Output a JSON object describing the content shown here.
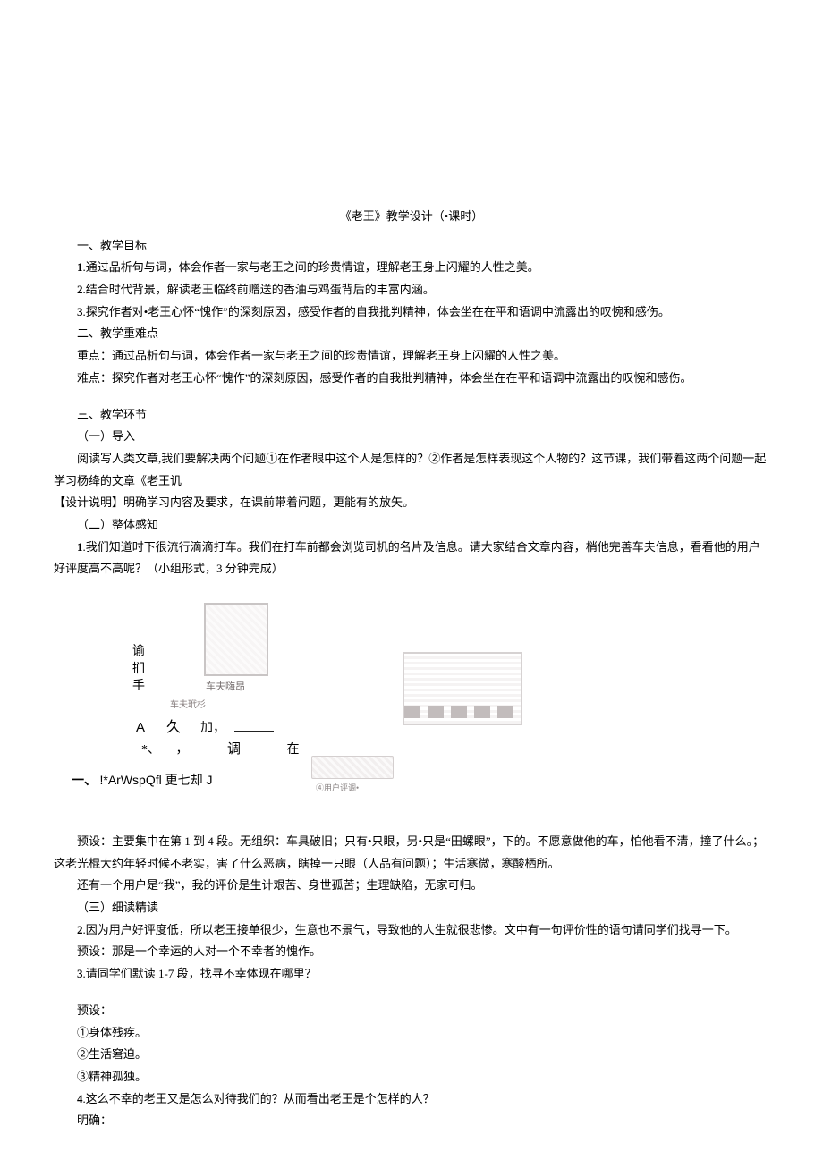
{
  "title": "《老王》教学设计（•课时）",
  "s1": {
    "h": "一、教学目标",
    "l1_num": "1",
    "l1": ".通过品析句与词，体会作者一家与老王之间的珍贵情谊，理解老王身上闪耀的人性之美。",
    "l2_num": "2",
    "l2": ".结合时代背景，解读老王临终前赠送的香油与鸡蛋背后的丰富内涵。",
    "l3_num": "3",
    "l3": ".探究作者对•老王心怀“愧作”的深刻原因，感受作者的自我批判精神，体会坐在在平和语调中流露出的叹惋和感伤。"
  },
  "s2": {
    "h": "二、教学重难点",
    "zd": "重点：通过品析句与词，体会作者一家与老王之间的珍贵情谊，理解老王身上闪耀的人性之美。",
    "nd": "难点：探究作者对老王心怀“愧作”的深刻原因，感受作者的自我批判精神，体会坐在在平和语调中流露出的叹惋和感伤。"
  },
  "s3": {
    "h": "三、教学环节",
    "h1": "（一）导入",
    "p1": "阅读写人类文章,我们要解决两个问题①在作者眼中这个人是怎样的？②作者是怎样表现这个人物的？这节课，我们带着这两个问题一起学习杨绛的文章《老王讥",
    "design": "【设计说明】明确学习内容及要求，在课前带着问题，更能有的放矢。",
    "h2": "（二）整体感知",
    "q1_num": "1",
    "q1": ".我们知道时下很流行滴滴打车。我们在打车前都会浏览司机的名片及信息。请大家结合文章内容，梢他完善车夫信息，看看他的用户好评度高不高呢？（小组形式，3 分钟完成）"
  },
  "illus": {
    "vert": "谕扪手",
    "cap1": "车夫嗨昂",
    "cap2": "车夫玳杉",
    "A": "A",
    "jiu": "久",
    "jia": "加，",
    "star": "*、",
    "comma": "，",
    "diao": "调",
    "zai": "在",
    "rowone_pre": "一、",
    "rowone_mid": "!*ArWspQfl 更七却 J",
    "small_label": "④用户评调•"
  },
  "yu": {
    "p1": "预设：主要集中在第 1 到 4 段。无组织：车具破旧；只有•只眼，另•只是“田螺眼”，下的。不愿意做他的车，怕他看不清，撞了什么。；这老光棍大约年轻时候不老实，害了什么恶病，瞎掉一只眼（人品有问题）；生活寒微，寒酸栖所。",
    "p2": "还有一个用户是“我”，我的评价是生计艰苦、身世孤苦；生理缺陷，无家可归。"
  },
  "s3b": {
    "h3": "（三）细读精读",
    "q2_num": "2",
    "q2": ".因为用户好评度低，所以老王接单很少，生意也不景气，导致他的人生就很悲惨。文中有一句评价性的语句请同学们找寻一下。",
    "ys1": "预设：那是一个幸运的人对一个不幸者的愧作。",
    "q3_num": "3",
    "q3": ".请同学们默读 1-7 段，找寻不幸体现在哪里？",
    "ys_h": "预设：",
    "a1": "①身体残疾。",
    "a2": "②生活窘迫。",
    "a3": "③精神孤独。",
    "q4_num": "4",
    "q4": ".这么不幸的老王又是怎么对待我们的？从而看出老王是个怎样的人？",
    "mq": "明确："
  }
}
